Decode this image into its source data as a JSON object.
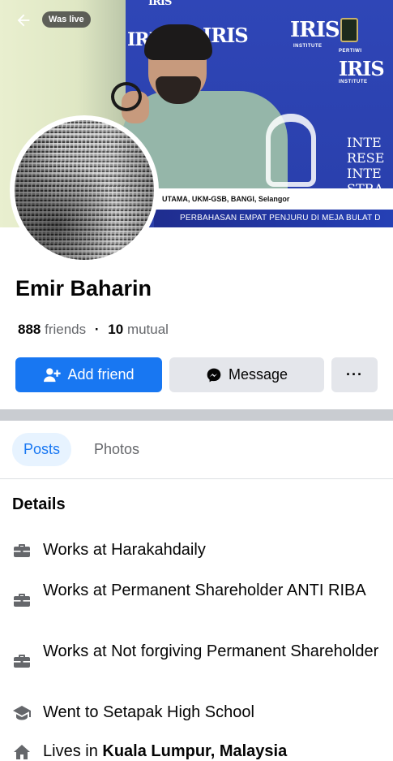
{
  "cover": {
    "was_live_label": "Was live",
    "logos": [
      "IRIS",
      "IRIS",
      "IRIS",
      "IRIS",
      "IRIS"
    ],
    "logo_sub": "INSTITUTE",
    "pertiwi_label": "PERTIWI",
    "banner_lines": [
      "INTE",
      "RESE",
      "INTE",
      "STRA"
    ],
    "caption": "UTAMA, UKM-GSB, BANGI, Selangor",
    "ticker": "PERBAHASAN EMPAT PENJURU DI MEJA BULAT D"
  },
  "profile": {
    "name": "Emir Baharin",
    "friends_count": "888",
    "friends_word": "friends",
    "separator": "·",
    "mutual_count": "10",
    "mutual_word": "mutual"
  },
  "actions": {
    "add_friend": "Add friend",
    "message": "Message",
    "more": "···"
  },
  "tabs": [
    {
      "label": "Posts",
      "active": true
    },
    {
      "label": "Photos",
      "active": false
    }
  ],
  "details": {
    "title": "Details",
    "items": [
      {
        "icon": "briefcase-icon",
        "text": "Works at Harakahdaily"
      },
      {
        "icon": "briefcase-icon",
        "text": "Works at Permanent Shareholder ANTI RIBA"
      },
      {
        "icon": "briefcase-icon",
        "text": "Works at Not forgiving Permanent Shareholder"
      },
      {
        "icon": "graduation-cap-icon",
        "text": "Went to Setapak High School"
      },
      {
        "icon": "home-icon",
        "prefix": "Lives in ",
        "bold": "Kuala Lumpur, Malaysia"
      }
    ]
  },
  "colors": {
    "accent": "#1877f2",
    "secondary_button": "#e4e6eb",
    "muted_text": "#65676b",
    "divider": "#c9ccd1"
  }
}
